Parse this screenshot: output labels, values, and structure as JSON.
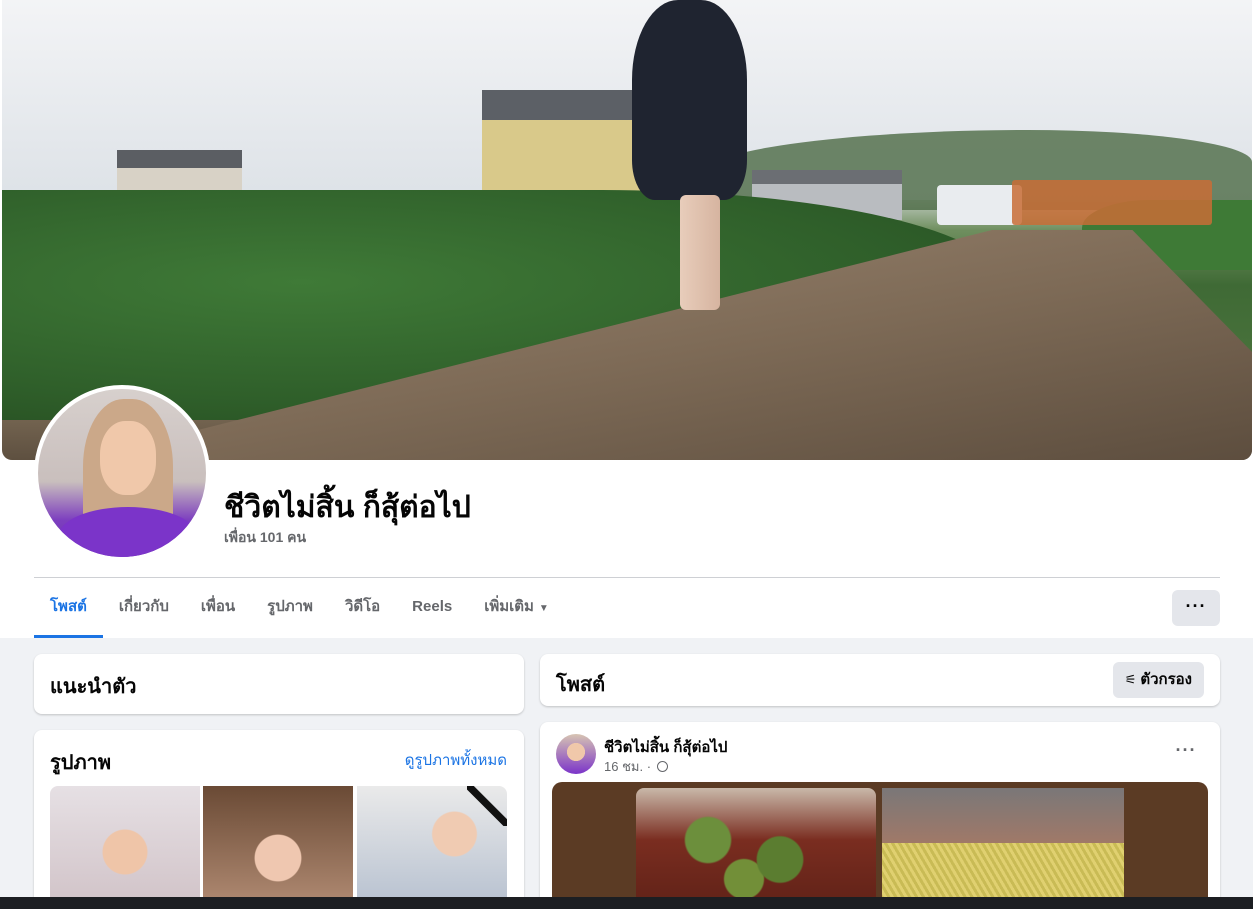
{
  "profile": {
    "name": "ชีวิตไม่สิ้น ก็สุ้ต่อไป",
    "friends": "เพื่อน 101 คน"
  },
  "tabs": [
    {
      "label": "โพสต์",
      "active": true
    },
    {
      "label": "เกี่ยวกับ"
    },
    {
      "label": "เพื่อน"
    },
    {
      "label": "รูปภาพ"
    },
    {
      "label": "วิดีโอ"
    },
    {
      "label": "Reels"
    },
    {
      "label": "เพิ่มเติม",
      "dropdown": true
    }
  ],
  "more_button": "···",
  "intro": {
    "title": "แนะนำตัว"
  },
  "photos": {
    "title": "รูปภาพ",
    "see_all": "ดูรูปภาพทั้งหมด"
  },
  "posts": {
    "title": "โพสต์",
    "filter_label": "ตัวกรอง",
    "filter_icon": "filter-sliders-icon"
  },
  "post": {
    "author": "ชีวิตไม่สิ้น ก็สุ้ต่อไป",
    "time": "16 ชม. ·",
    "privacy_icon": "globe-icon",
    "more": "···"
  },
  "colors": {
    "accent": "#1b74e4",
    "page_bg": "#f0f2f5",
    "secondary_text": "#65676b",
    "button_bg": "#e4e6eb"
  }
}
